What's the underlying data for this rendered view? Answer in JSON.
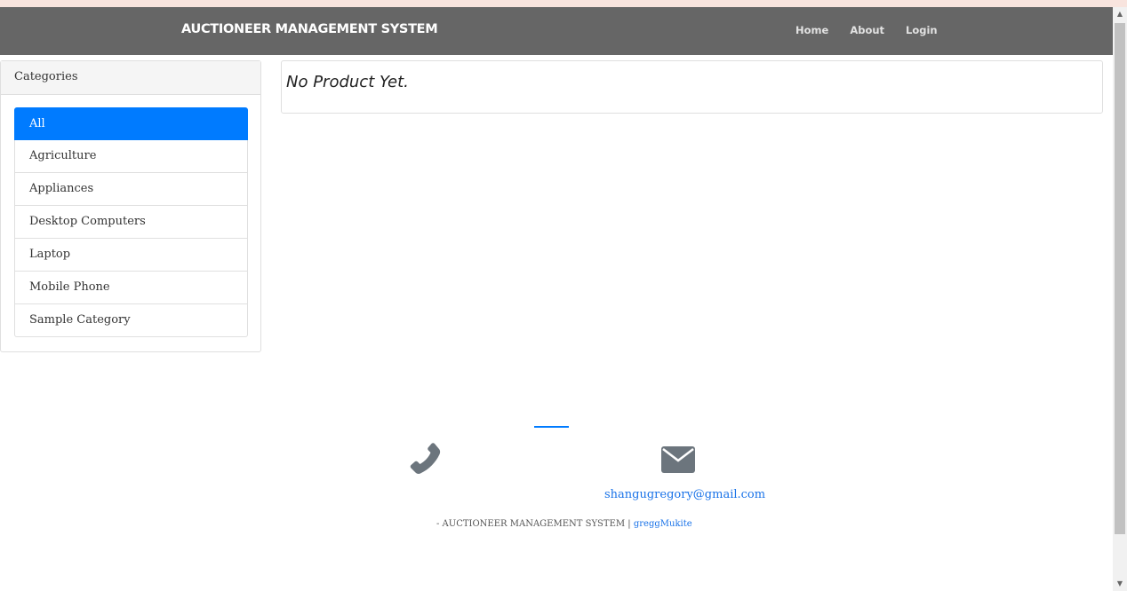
{
  "navbar": {
    "brand": "AUCTIONEER MANAGEMENT SYSTEM",
    "links": [
      "Home",
      "About",
      "Login"
    ]
  },
  "sidebar": {
    "title": "Categories",
    "items": [
      "All",
      "Agriculture",
      "Appliances",
      "Desktop Computers",
      "Laptop",
      "Mobile Phone",
      "Sample Category"
    ],
    "active_item": "All"
  },
  "main": {
    "empty_message": "No Product Yet."
  },
  "footer": {
    "phone_icon": "phone-icon",
    "mail_icon": "envelope-icon",
    "email": "shangugregory@gmail.com",
    "copyright": "- AUCTIONEER MANAGEMENT SYSTEM",
    "separator": "|",
    "author": "greggMukite"
  },
  "colors": {
    "navbar_bg": "#666666",
    "accent": "#007bff",
    "link": "#1a73e8"
  }
}
